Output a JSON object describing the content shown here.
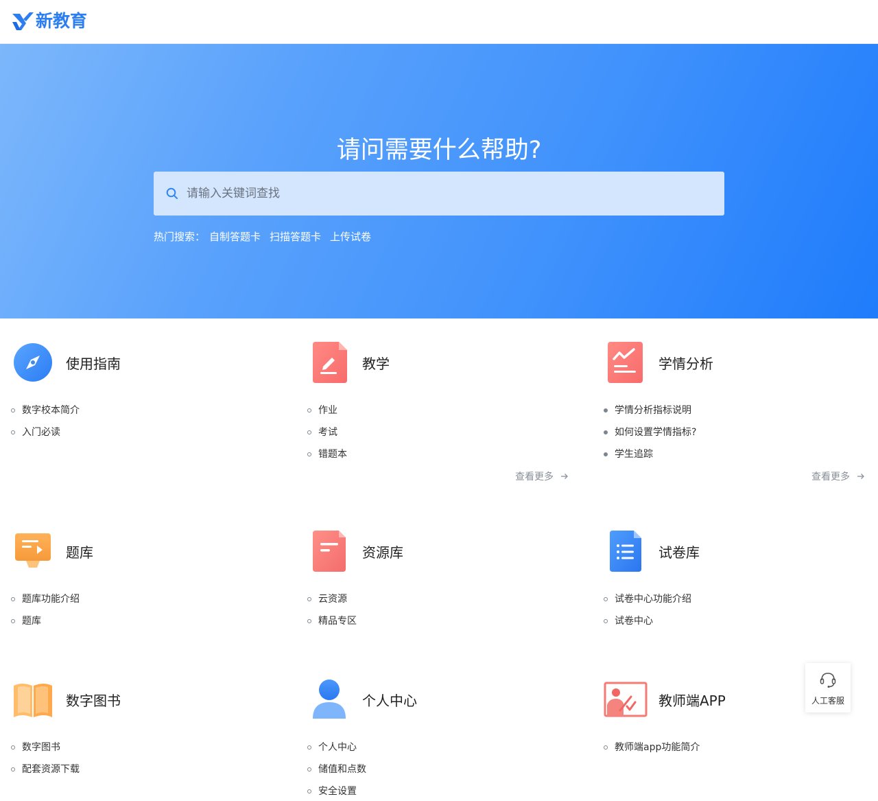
{
  "brand": {
    "name": "新教育"
  },
  "hero": {
    "title": "请问需要什么帮助?",
    "search_placeholder": "请输入关键词查找",
    "hot_label": "热门搜索：",
    "hot_links": [
      "自制答题卡",
      "扫描答题卡",
      "上传试卷"
    ]
  },
  "cards": [
    {
      "title": "使用指南",
      "icon": "compass-icon",
      "items": [
        "数字校本简介",
        "入门必读"
      ]
    },
    {
      "title": "教学",
      "icon": "edit-document-icon",
      "items": [
        "作业",
        "考试",
        "错题本"
      ],
      "more": "查看更多"
    },
    {
      "title": "学情分析",
      "icon": "analysis-chart-icon",
      "items": [
        "学情分析指标说明",
        "如何设置学情指标?",
        "学生追踪"
      ],
      "more": "查看更多"
    },
    {
      "title": "题库",
      "icon": "presentation-board-icon",
      "items": [
        "题库功能介绍",
        "题库"
      ]
    },
    {
      "title": "资源库",
      "icon": "resource-document-icon",
      "items": [
        "云资源",
        "精品专区"
      ]
    },
    {
      "title": "试卷库",
      "icon": "list-document-icon",
      "items": [
        "试卷中心功能介绍",
        "试卷中心"
      ]
    },
    {
      "title": "数字图书",
      "icon": "open-book-icon",
      "items": [
        "数字图书",
        "配套资源下载"
      ]
    },
    {
      "title": "个人中心",
      "icon": "user-icon",
      "items": [
        "个人中心",
        "储值和点数",
        "安全设置"
      ]
    },
    {
      "title": "教师端APP",
      "icon": "teacher-screen-icon",
      "items": [
        "教师端app功能简介"
      ]
    }
  ],
  "customer_service": {
    "label": "人工客服",
    "icon": "headset-icon"
  },
  "colors": {
    "primary": "#2d7ff0",
    "hero_start": "#7cb7fb",
    "hero_end": "#1f7cfb",
    "text": "#333333",
    "muted": "#8a9099"
  }
}
